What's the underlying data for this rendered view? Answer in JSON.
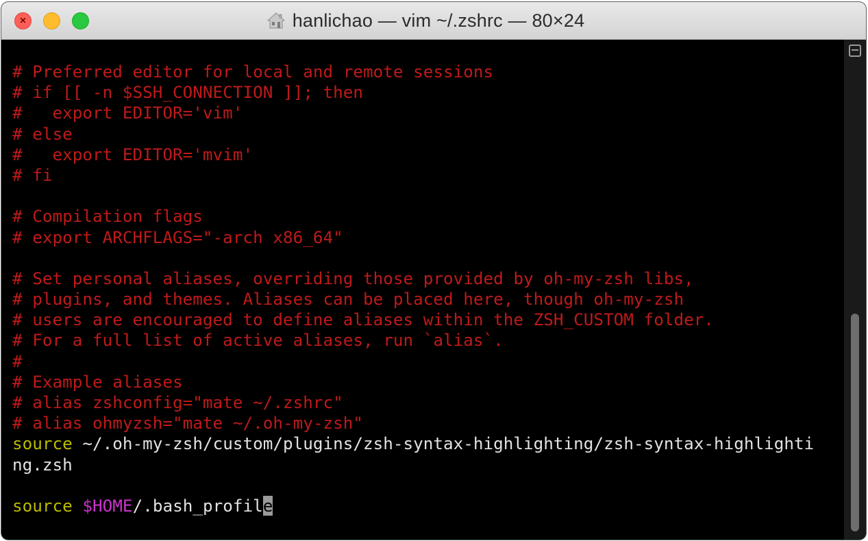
{
  "window": {
    "title": "hanlichao — vim ~/.zshrc — 80×24",
    "title_icon": "home-folder-icon"
  },
  "colors": {
    "comment": "#be1a1a",
    "command": "#bbbb00",
    "variable": "#cc33cc",
    "text": "#e2e2e2",
    "background": "#000000"
  },
  "terminal": {
    "lines": [
      [
        {
          "t": "# Preferred editor for local and remote sessions",
          "c": "comment"
        }
      ],
      [
        {
          "t": "# if [[ -n $SSH_CONNECTION ]]; then",
          "c": "comment"
        }
      ],
      [
        {
          "t": "#   export EDITOR='vim'",
          "c": "comment"
        }
      ],
      [
        {
          "t": "# else",
          "c": "comment"
        }
      ],
      [
        {
          "t": "#   export EDITOR='mvim'",
          "c": "comment"
        }
      ],
      [
        {
          "t": "# fi",
          "c": "comment"
        }
      ],
      [],
      [
        {
          "t": "# Compilation flags",
          "c": "comment"
        }
      ],
      [
        {
          "t": "# export ARCHFLAGS=\"-arch x86_64\"",
          "c": "comment"
        }
      ],
      [],
      [
        {
          "t": "# Set personal aliases, overriding those provided by oh-my-zsh libs,",
          "c": "comment"
        }
      ],
      [
        {
          "t": "# plugins, and themes. Aliases can be placed here, though oh-my-zsh",
          "c": "comment"
        }
      ],
      [
        {
          "t": "# users are encouraged to define aliases within the ZSH_CUSTOM folder.",
          "c": "comment"
        }
      ],
      [
        {
          "t": "# For a full list of active aliases, run `alias`.",
          "c": "comment"
        }
      ],
      [
        {
          "t": "#",
          "c": "comment"
        }
      ],
      [
        {
          "t": "# Example aliases",
          "c": "comment"
        }
      ],
      [
        {
          "t": "# alias zshconfig=\"mate ~/.zshrc\"",
          "c": "comment"
        }
      ],
      [
        {
          "t": "# alias ohmyzsh=\"mate ~/.oh-my-zsh\"",
          "c": "comment"
        }
      ],
      [
        {
          "t": "source",
          "c": "command"
        },
        {
          "t": " ~/.oh-my-zsh/custom/plugins/zsh-syntax-highlighting/zsh-syntax-highlighti",
          "c": "plain"
        }
      ],
      [
        {
          "t": "ng.zsh",
          "c": "plain"
        }
      ],
      [],
      [
        {
          "t": "source",
          "c": "command"
        },
        {
          "t": " ",
          "c": "plain"
        },
        {
          "t": "$HOME",
          "c": "variable"
        },
        {
          "t": "/.bash_profil",
          "c": "plain"
        },
        {
          "t": "e",
          "c": "cursor"
        }
      ]
    ]
  },
  "scrollbar": {
    "thumb_start": 0.53,
    "thumb_end": 1.0
  }
}
